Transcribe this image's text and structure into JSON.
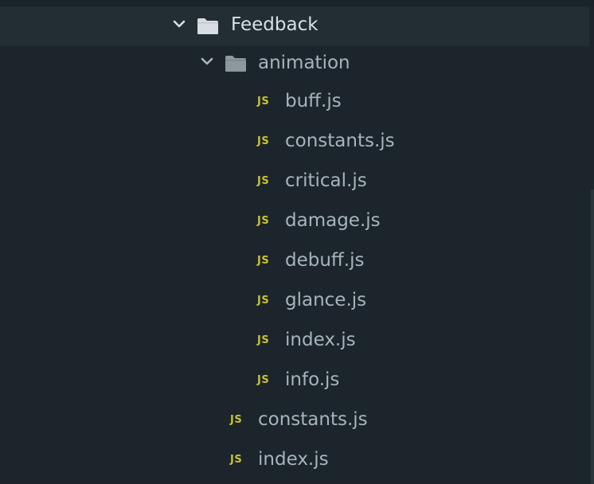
{
  "tree": {
    "root": {
      "label": "Feedback",
      "icon": "folder-icon",
      "expanded": true
    },
    "subfolder": {
      "label": "animation",
      "icon": "folder-icon",
      "expanded": true
    },
    "subfolder_files": [
      {
        "badge": "JS",
        "label": "buff.js"
      },
      {
        "badge": "JS",
        "label": "constants.js"
      },
      {
        "badge": "JS",
        "label": "critical.js"
      },
      {
        "badge": "JS",
        "label": "damage.js"
      },
      {
        "badge": "JS",
        "label": "debuff.js"
      },
      {
        "badge": "JS",
        "label": "glance.js"
      },
      {
        "badge": "JS",
        "label": "index.js"
      },
      {
        "badge": "JS",
        "label": "info.js"
      }
    ],
    "root_files": [
      {
        "badge": "JS",
        "label": "constants.js"
      },
      {
        "badge": "JS",
        "label": "index.js"
      }
    ]
  },
  "colors": {
    "background": "#1c252c",
    "selected_row": "#222d34",
    "text": "#a6b4bc",
    "js_badge": "#c9c232",
    "folder_root": "#d7dde0",
    "folder_sub": "#8c979e"
  }
}
